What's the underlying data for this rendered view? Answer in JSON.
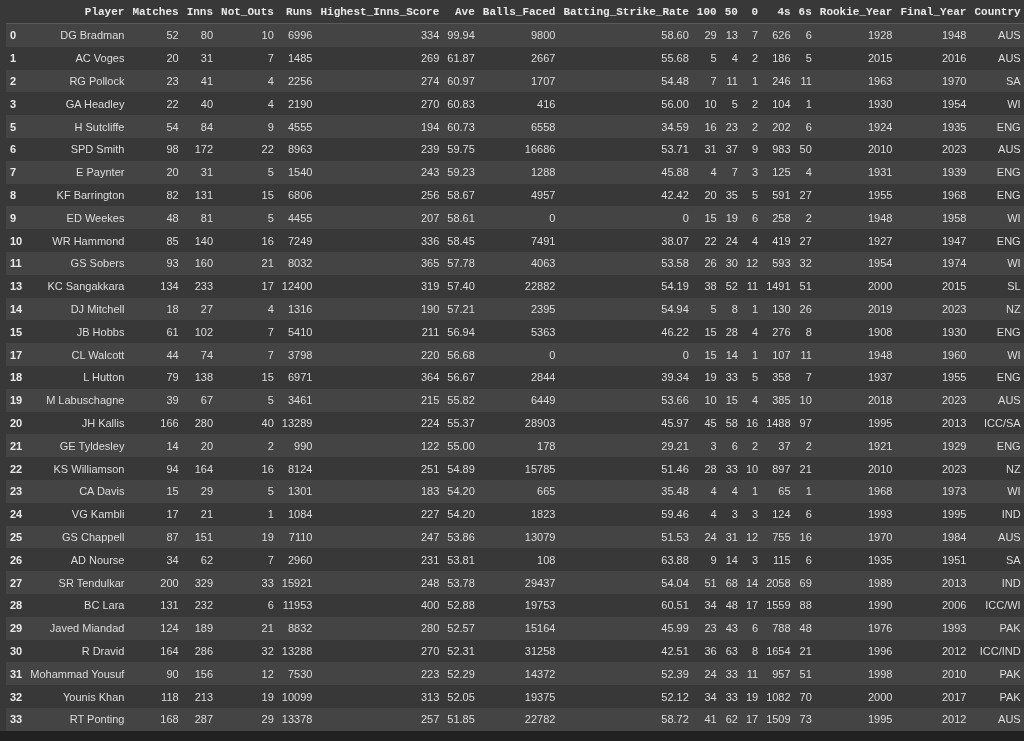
{
  "table": {
    "columns": [
      "Player",
      "Matches",
      "Inns",
      "Not_Outs",
      "Runs",
      "Highest_Inns_Score",
      "Ave",
      "Balls_Faced",
      "Batting_Strike_Rate",
      "100",
      "50",
      "0",
      "4s",
      "6s",
      "Rookie_Year",
      "Final_Year",
      "Country"
    ],
    "rows": [
      {
        "index": "0",
        "cells": [
          "DG Bradman",
          "52",
          "80",
          "10",
          "6996",
          "334",
          "99.94",
          "9800",
          "58.60",
          "29",
          "13",
          "7",
          "626",
          "6",
          "1928",
          "1948",
          "AUS"
        ]
      },
      {
        "index": "1",
        "cells": [
          "AC Voges",
          "20",
          "31",
          "7",
          "1485",
          "269",
          "61.87",
          "2667",
          "55.68",
          "5",
          "4",
          "2",
          "186",
          "5",
          "2015",
          "2016",
          "AUS"
        ]
      },
      {
        "index": "2",
        "cells": [
          "RG Pollock",
          "23",
          "41",
          "4",
          "2256",
          "274",
          "60.97",
          "1707",
          "54.48",
          "7",
          "11",
          "1",
          "246",
          "11",
          "1963",
          "1970",
          "SA"
        ]
      },
      {
        "index": "3",
        "cells": [
          "GA Headley",
          "22",
          "40",
          "4",
          "2190",
          "270",
          "60.83",
          "416",
          "56.00",
          "10",
          "5",
          "2",
          "104",
          "1",
          "1930",
          "1954",
          "WI"
        ]
      },
      {
        "index": "5",
        "cells": [
          "H Sutcliffe",
          "54",
          "84",
          "9",
          "4555",
          "194",
          "60.73",
          "6558",
          "34.59",
          "16",
          "23",
          "2",
          "202",
          "6",
          "1924",
          "1935",
          "ENG"
        ]
      },
      {
        "index": "6",
        "cells": [
          "SPD Smith",
          "98",
          "172",
          "22",
          "8963",
          "239",
          "59.75",
          "16686",
          "53.71",
          "31",
          "37",
          "9",
          "983",
          "50",
          "2010",
          "2023",
          "AUS"
        ]
      },
      {
        "index": "7",
        "cells": [
          "E Paynter",
          "20",
          "31",
          "5",
          "1540",
          "243",
          "59.23",
          "1288",
          "45.88",
          "4",
          "7",
          "3",
          "125",
          "4",
          "1931",
          "1939",
          "ENG"
        ]
      },
      {
        "index": "8",
        "cells": [
          "KF Barrington",
          "82",
          "131",
          "15",
          "6806",
          "256",
          "58.67",
          "4957",
          "42.42",
          "20",
          "35",
          "5",
          "591",
          "27",
          "1955",
          "1968",
          "ENG"
        ]
      },
      {
        "index": "9",
        "cells": [
          "ED Weekes",
          "48",
          "81",
          "5",
          "4455",
          "207",
          "58.61",
          "0",
          "0",
          "15",
          "19",
          "6",
          "258",
          "2",
          "1948",
          "1958",
          "WI"
        ]
      },
      {
        "index": "10",
        "cells": [
          "WR Hammond",
          "85",
          "140",
          "16",
          "7249",
          "336",
          "58.45",
          "7491",
          "38.07",
          "22",
          "24",
          "4",
          "419",
          "27",
          "1927",
          "1947",
          "ENG"
        ]
      },
      {
        "index": "11",
        "cells": [
          "GS Sobers",
          "93",
          "160",
          "21",
          "8032",
          "365",
          "57.78",
          "4063",
          "53.58",
          "26",
          "30",
          "12",
          "593",
          "32",
          "1954",
          "1974",
          "WI"
        ]
      },
      {
        "index": "13",
        "cells": [
          "KC Sangakkara",
          "134",
          "233",
          "17",
          "12400",
          "319",
          "57.40",
          "22882",
          "54.19",
          "38",
          "52",
          "11",
          "1491",
          "51",
          "2000",
          "2015",
          "SL"
        ]
      },
      {
        "index": "14",
        "cells": [
          "DJ Mitchell",
          "18",
          "27",
          "4",
          "1316",
          "190",
          "57.21",
          "2395",
          "54.94",
          "5",
          "8",
          "1",
          "130",
          "26",
          "2019",
          "2023",
          "NZ"
        ]
      },
      {
        "index": "15",
        "cells": [
          "JB Hobbs",
          "61",
          "102",
          "7",
          "5410",
          "211",
          "56.94",
          "5363",
          "46.22",
          "15",
          "28",
          "4",
          "276",
          "8",
          "1908",
          "1930",
          "ENG"
        ]
      },
      {
        "index": "17",
        "cells": [
          "CL Walcott",
          "44",
          "74",
          "7",
          "3798",
          "220",
          "56.68",
          "0",
          "0",
          "15",
          "14",
          "1",
          "107",
          "11",
          "1948",
          "1960",
          "WI"
        ]
      },
      {
        "index": "18",
        "cells": [
          "L Hutton",
          "79",
          "138",
          "15",
          "6971",
          "364",
          "56.67",
          "2844",
          "39.34",
          "19",
          "33",
          "5",
          "358",
          "7",
          "1937",
          "1955",
          "ENG"
        ]
      },
      {
        "index": "19",
        "cells": [
          "M Labuschagne",
          "39",
          "67",
          "5",
          "3461",
          "215",
          "55.82",
          "6449",
          "53.66",
          "10",
          "15",
          "4",
          "385",
          "10",
          "2018",
          "2023",
          "AUS"
        ]
      },
      {
        "index": "20",
        "cells": [
          "JH Kallis",
          "166",
          "280",
          "40",
          "13289",
          "224",
          "55.37",
          "28903",
          "45.97",
          "45",
          "58",
          "16",
          "1488",
          "97",
          "1995",
          "2013",
          "ICC/SA"
        ]
      },
      {
        "index": "21",
        "cells": [
          "GE Tyldesley",
          "14",
          "20",
          "2",
          "990",
          "122",
          "55.00",
          "178",
          "29.21",
          "3",
          "6",
          "2",
          "37",
          "2",
          "1921",
          "1929",
          "ENG"
        ]
      },
      {
        "index": "22",
        "cells": [
          "KS Williamson",
          "94",
          "164",
          "16",
          "8124",
          "251",
          "54.89",
          "15785",
          "51.46",
          "28",
          "33",
          "10",
          "897",
          "21",
          "2010",
          "2023",
          "NZ"
        ]
      },
      {
        "index": "23",
        "cells": [
          "CA Davis",
          "15",
          "29",
          "5",
          "1301",
          "183",
          "54.20",
          "665",
          "35.48",
          "4",
          "4",
          "1",
          "65",
          "1",
          "1968",
          "1973",
          "WI"
        ]
      },
      {
        "index": "24",
        "cells": [
          "VG Kambli",
          "17",
          "21",
          "1",
          "1084",
          "227",
          "54.20",
          "1823",
          "59.46",
          "4",
          "3",
          "3",
          "124",
          "6",
          "1993",
          "1995",
          "IND"
        ]
      },
      {
        "index": "25",
        "cells": [
          "GS Chappell",
          "87",
          "151",
          "19",
          "7110",
          "247",
          "53.86",
          "13079",
          "51.53",
          "24",
          "31",
          "12",
          "755",
          "16",
          "1970",
          "1984",
          "AUS"
        ]
      },
      {
        "index": "26",
        "cells": [
          "AD Nourse",
          "34",
          "62",
          "7",
          "2960",
          "231",
          "53.81",
          "108",
          "63.88",
          "9",
          "14",
          "3",
          "115",
          "6",
          "1935",
          "1951",
          "SA"
        ]
      },
      {
        "index": "27",
        "cells": [
          "SR Tendulkar",
          "200",
          "329",
          "33",
          "15921",
          "248",
          "53.78",
          "29437",
          "54.04",
          "51",
          "68",
          "14",
          "2058",
          "69",
          "1989",
          "2013",
          "IND"
        ]
      },
      {
        "index": "28",
        "cells": [
          "BC Lara",
          "131",
          "232",
          "6",
          "11953",
          "400",
          "52.88",
          "19753",
          "60.51",
          "34",
          "48",
          "17",
          "1559",
          "88",
          "1990",
          "2006",
          "ICC/WI"
        ]
      },
      {
        "index": "29",
        "cells": [
          "Javed Miandad",
          "124",
          "189",
          "21",
          "8832",
          "280",
          "52.57",
          "15164",
          "45.99",
          "23",
          "43",
          "6",
          "788",
          "48",
          "1976",
          "1993",
          "PAK"
        ]
      },
      {
        "index": "30",
        "cells": [
          "R Dravid",
          "164",
          "286",
          "32",
          "13288",
          "270",
          "52.31",
          "31258",
          "42.51",
          "36",
          "63",
          "8",
          "1654",
          "21",
          "1996",
          "2012",
          "ICC/IND"
        ]
      },
      {
        "index": "31",
        "cells": [
          "Mohammad Yousuf",
          "90",
          "156",
          "12",
          "7530",
          "223",
          "52.29",
          "14372",
          "52.39",
          "24",
          "33",
          "11",
          "957",
          "51",
          "1998",
          "2010",
          "PAK"
        ]
      },
      {
        "index": "32",
        "cells": [
          "Younis Khan",
          "118",
          "213",
          "19",
          "10099",
          "313",
          "52.05",
          "19375",
          "52.12",
          "34",
          "33",
          "19",
          "1082",
          "70",
          "2000",
          "2017",
          "PAK"
        ]
      },
      {
        "index": "33",
        "cells": [
          "RT Ponting",
          "168",
          "287",
          "29",
          "13378",
          "257",
          "51.85",
          "22782",
          "58.72",
          "41",
          "62",
          "17",
          "1509",
          "73",
          "1995",
          "2012",
          "AUS"
        ]
      }
    ]
  }
}
